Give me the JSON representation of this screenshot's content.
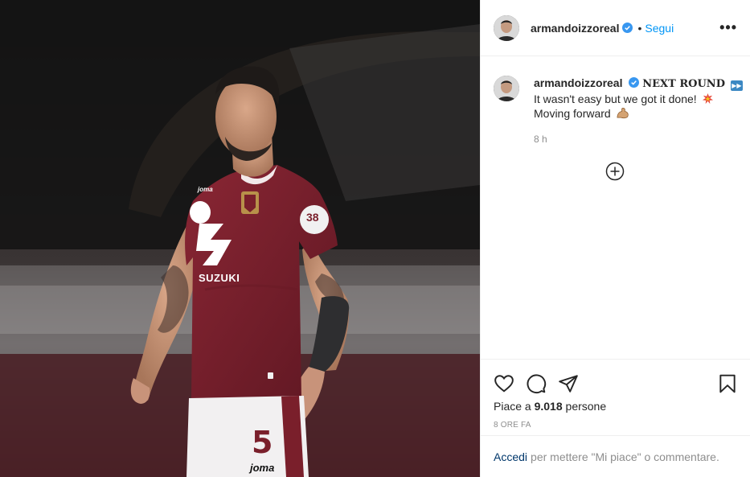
{
  "header": {
    "username": "armandoizzoreal",
    "separator": "•",
    "follow_label": "Segui",
    "more_label": "•••"
  },
  "caption": {
    "username": "armandoizzoreal",
    "headline": "NEXT ROUND",
    "line1": "It wasn't easy but we got it done!",
    "line2": "Moving forward",
    "time": "8 h"
  },
  "photo": {
    "jersey_sponsor": "SUZUKI",
    "jersey_number": "5",
    "shorts_brand": "joma",
    "sleeve_patch": "38",
    "kit_brand": "joma"
  },
  "footer": {
    "likes_prefix": "Piace a ",
    "likes_count": "9.018",
    "likes_suffix": " persone",
    "post_time": "8 ORE FA",
    "login_link": "Accedi",
    "login_text": "per mettere \"Mi piace\" o commentare."
  },
  "colors": {
    "follow": "#0095f6",
    "verified": "#3897f0",
    "jersey": "#7a1f2b",
    "link": "#00376b"
  },
  "icons": {
    "like": "heart-icon",
    "comment": "comment-icon",
    "share": "paper-plane-icon",
    "save": "bookmark-icon",
    "load_more": "plus-circle-icon"
  }
}
